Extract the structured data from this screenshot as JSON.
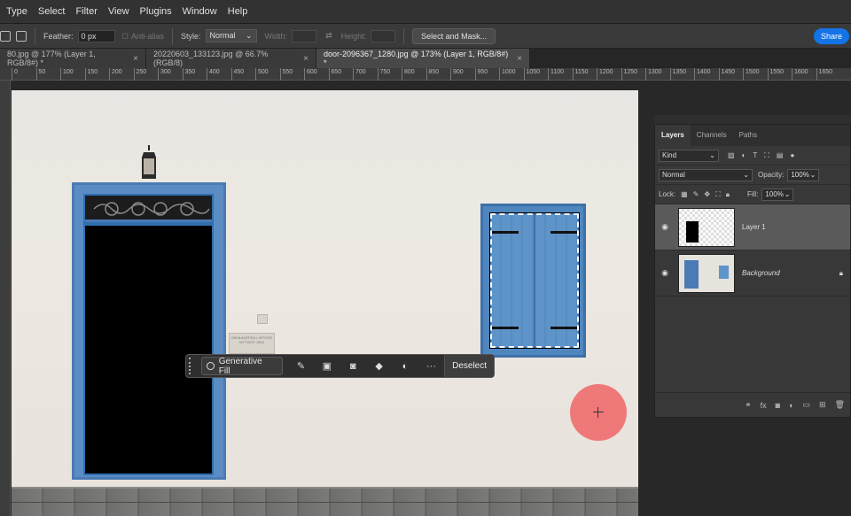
{
  "menu": [
    "Type",
    "Select",
    "Filter",
    "View",
    "Plugins",
    "Window",
    "Help"
  ],
  "options": {
    "feather_label": "Feather:",
    "feather_value": "0 px",
    "antialias_label": "Anti-alias",
    "style_label": "Style:",
    "style_value": "Normal",
    "width_label": "Width:",
    "height_label": "Height:",
    "select_mask_label": "Select and Mask...",
    "share_label": "Share"
  },
  "tabs": [
    {
      "label": "80.jpg @ 177% (Layer 1, RGB/8#) *",
      "close": "×"
    },
    {
      "label": "20220603_133123.jpg @ 66.7% (RGB/8)",
      "close": "×"
    },
    {
      "label": "door-2096367_1280.jpg @ 173% (Layer 1, RGB/8#) *",
      "close": "×"
    }
  ],
  "ruler": [
    "0",
    "50",
    "100",
    "150",
    "200",
    "250",
    "300",
    "350",
    "400",
    "450",
    "500",
    "550",
    "600",
    "650",
    "700",
    "750",
    "800",
    "850",
    "900",
    "950",
    "1000",
    "1050",
    "1100",
    "1150",
    "1200",
    "1250",
    "1300",
    "1350",
    "1400",
    "1450",
    "1500",
    "1550",
    "1600",
    "1650"
  ],
  "taskbar": {
    "generative_fill": "Generative Fill",
    "more": "···",
    "deselect": "Deselect"
  },
  "plaque_text": "ΟΙΚΙΑ ΑΝΤΡΕΑ • ΧΡΥΣΗΣ ΜΥΤΙΛΟΥ\n1963",
  "layers_panel": {
    "tabs": [
      "Layers",
      "Channels",
      "Paths"
    ],
    "kind_label": "Kind",
    "blend_mode": "Normal",
    "opacity_label": "Opacity:",
    "opacity_value": "100%",
    "lock_label": "Lock:",
    "fill_label": "Fill:",
    "fill_value": "100%",
    "layers": [
      {
        "name": "Layer 1"
      },
      {
        "name": "Background"
      }
    ]
  }
}
